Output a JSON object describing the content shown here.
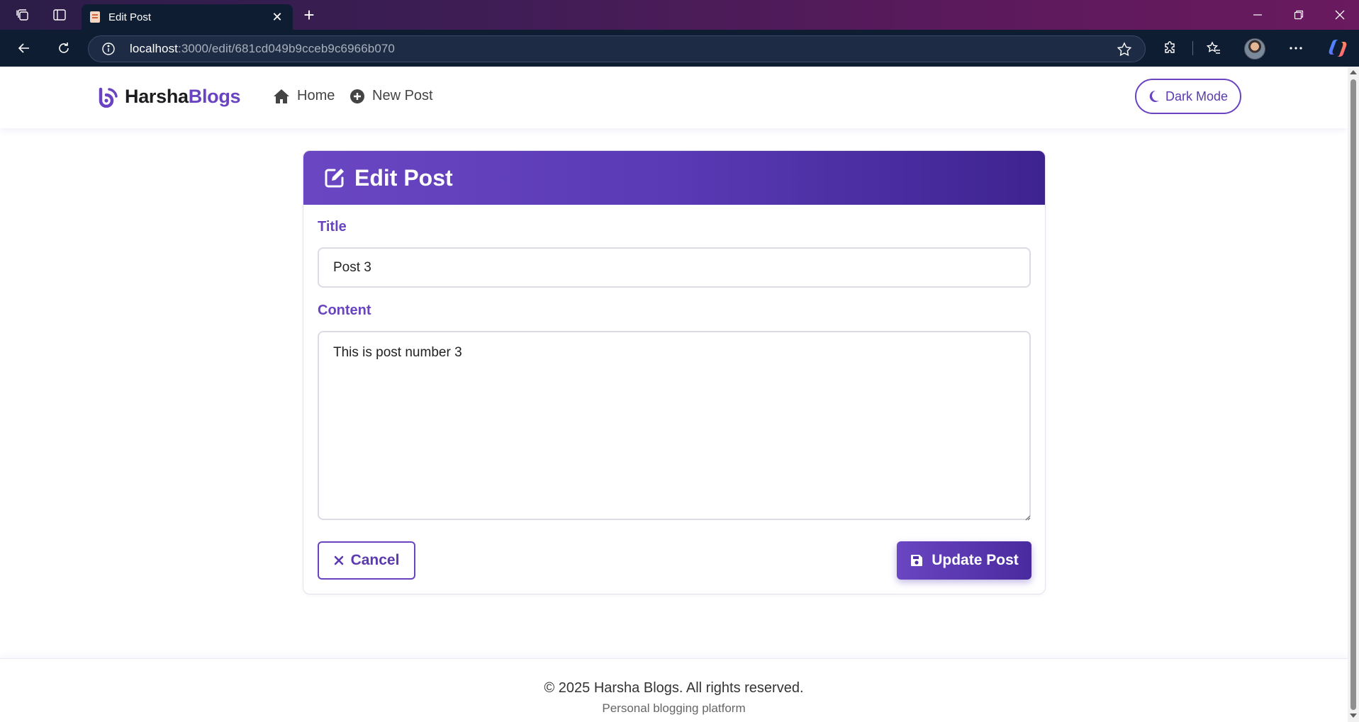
{
  "browser": {
    "tab_title": "Edit Post",
    "tab_close": "✕",
    "new_tab": "+",
    "url_host": "localhost",
    "url_rest": ":3000/edit/681cd049b9cceb9c6966b070"
  },
  "site": {
    "brand_main": "Harsha",
    "brand_accent": "Blogs",
    "nav": [
      {
        "label": "Home",
        "icon": "home-icon"
      },
      {
        "label": "New Post",
        "icon": "plus-circle-icon"
      }
    ],
    "dark_mode_label": "Dark Mode"
  },
  "form": {
    "heading": "Edit Post",
    "title_label": "Title",
    "title_value": "Post 3",
    "content_label": "Content",
    "content_value": "This is post number 3",
    "cancel_label": "Cancel",
    "update_label": "Update Post"
  },
  "footer": {
    "copyright": "© 2025 Harsha Blogs. All rights reserved.",
    "tagline": "Personal blogging platform"
  },
  "colors": {
    "accent": "#6a43c1",
    "header_gradient_end": "#3e2390",
    "browser_toolbar": "#0f1d33"
  }
}
